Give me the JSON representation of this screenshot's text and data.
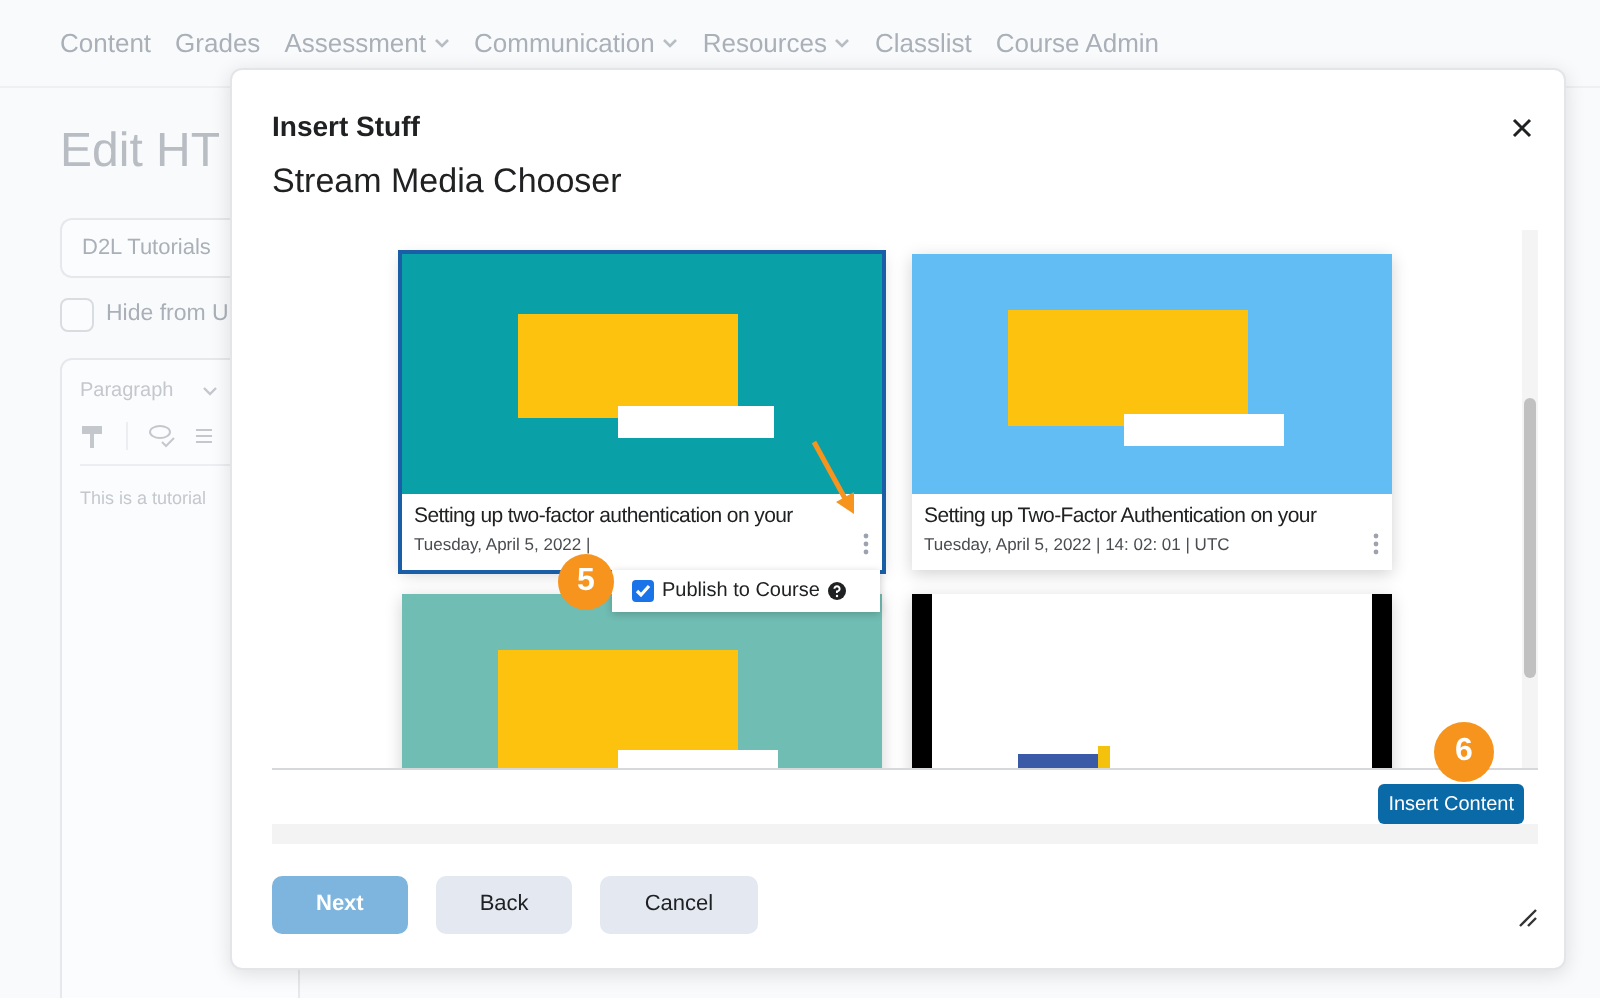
{
  "background": {
    "nav": [
      {
        "label": "Content",
        "dropdown": false
      },
      {
        "label": "Grades",
        "dropdown": false
      },
      {
        "label": "Assessment",
        "dropdown": true
      },
      {
        "label": "Communication",
        "dropdown": true
      },
      {
        "label": "Resources",
        "dropdown": true
      },
      {
        "label": "Classlist",
        "dropdown": false
      },
      {
        "label": "Course Admin",
        "dropdown": false
      }
    ],
    "heading": "Edit HT",
    "title_field": "D2L Tutorials",
    "hide_checkbox": {
      "label": "Hide from U",
      "checked": false
    },
    "editor": {
      "format": "Paragraph",
      "body": "This is a tutorial"
    }
  },
  "dialog": {
    "title": "Insert Stuff",
    "subtitle": "Stream Media Chooser",
    "videos": [
      {
        "kind": "teal",
        "title": "Setting up two-factor authentication on your",
        "date": "Tuesday, April 5, 2022 |",
        "selected": true
      },
      {
        "kind": "blue",
        "title": "Setting up Two-Factor Authentication on your",
        "date": "Tuesday, April 5, 2022 | 14: 02: 01 | UTC",
        "selected": false
      },
      {
        "kind": "mint",
        "selected": false
      },
      {
        "kind": "document",
        "selected": false
      }
    ],
    "popup": {
      "label": "Publish to Course",
      "checked": true
    },
    "callouts": [
      "5",
      "6"
    ],
    "insert_button": "Insert Content",
    "buttons": [
      {
        "label": "Next",
        "kind": "primary",
        "disabled": true
      },
      {
        "label": "Back",
        "kind": "secondary",
        "disabled": false
      },
      {
        "label": "Cancel",
        "kind": "secondary",
        "disabled": false
      }
    ]
  }
}
